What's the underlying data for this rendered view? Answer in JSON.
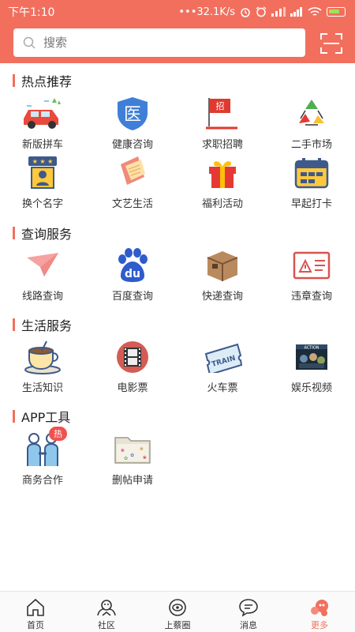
{
  "status_bar": {
    "time": "下午1:10",
    "network_speed": "•••32.1K/s"
  },
  "search": {
    "placeholder": "搜索"
  },
  "sections": [
    {
      "title": "热点推荐",
      "items": [
        {
          "label": "新版拼车",
          "icon": "car-icon"
        },
        {
          "label": "健康咨询",
          "icon": "medical-shield-icon"
        },
        {
          "label": "求职招聘",
          "icon": "recruit-flag-icon"
        },
        {
          "label": "二手市场",
          "icon": "recycle-icon"
        },
        {
          "label": "换个名字",
          "icon": "name-card-icon"
        },
        {
          "label": "文艺生活",
          "icon": "notebook-icon"
        },
        {
          "label": "福利活动",
          "icon": "gift-icon"
        },
        {
          "label": "早起打卡",
          "icon": "calendar-icon"
        }
      ]
    },
    {
      "title": "查询服务",
      "items": [
        {
          "label": "线路查询",
          "icon": "paper-plane-icon"
        },
        {
          "label": "百度查询",
          "icon": "baidu-paw-icon"
        },
        {
          "label": "快递查询",
          "icon": "package-icon"
        },
        {
          "label": "违章查询",
          "icon": "violation-card-icon"
        }
      ]
    },
    {
      "title": "生活服务",
      "items": [
        {
          "label": "生活知识",
          "icon": "coffee-cup-icon"
        },
        {
          "label": "电影票",
          "icon": "film-reel-icon"
        },
        {
          "label": "火车票",
          "icon": "train-ticket-icon"
        },
        {
          "label": "娱乐视频",
          "icon": "movie-poster-icon"
        }
      ]
    },
    {
      "title": "APP工具",
      "items": [
        {
          "label": "商务合作",
          "icon": "handshake-people-icon",
          "badge": "热"
        },
        {
          "label": "删帖申请",
          "icon": "folder-icon"
        }
      ]
    }
  ],
  "tabs": [
    {
      "label": "首页",
      "icon": "home-icon"
    },
    {
      "label": "社区",
      "icon": "community-icon"
    },
    {
      "label": "上蔡圈",
      "icon": "circle-eye-icon"
    },
    {
      "label": "消息",
      "icon": "chat-bubble-icon"
    },
    {
      "label": "更多",
      "icon": "more-icon",
      "active": true
    }
  ],
  "colors": {
    "accent": "#f26f5e"
  }
}
